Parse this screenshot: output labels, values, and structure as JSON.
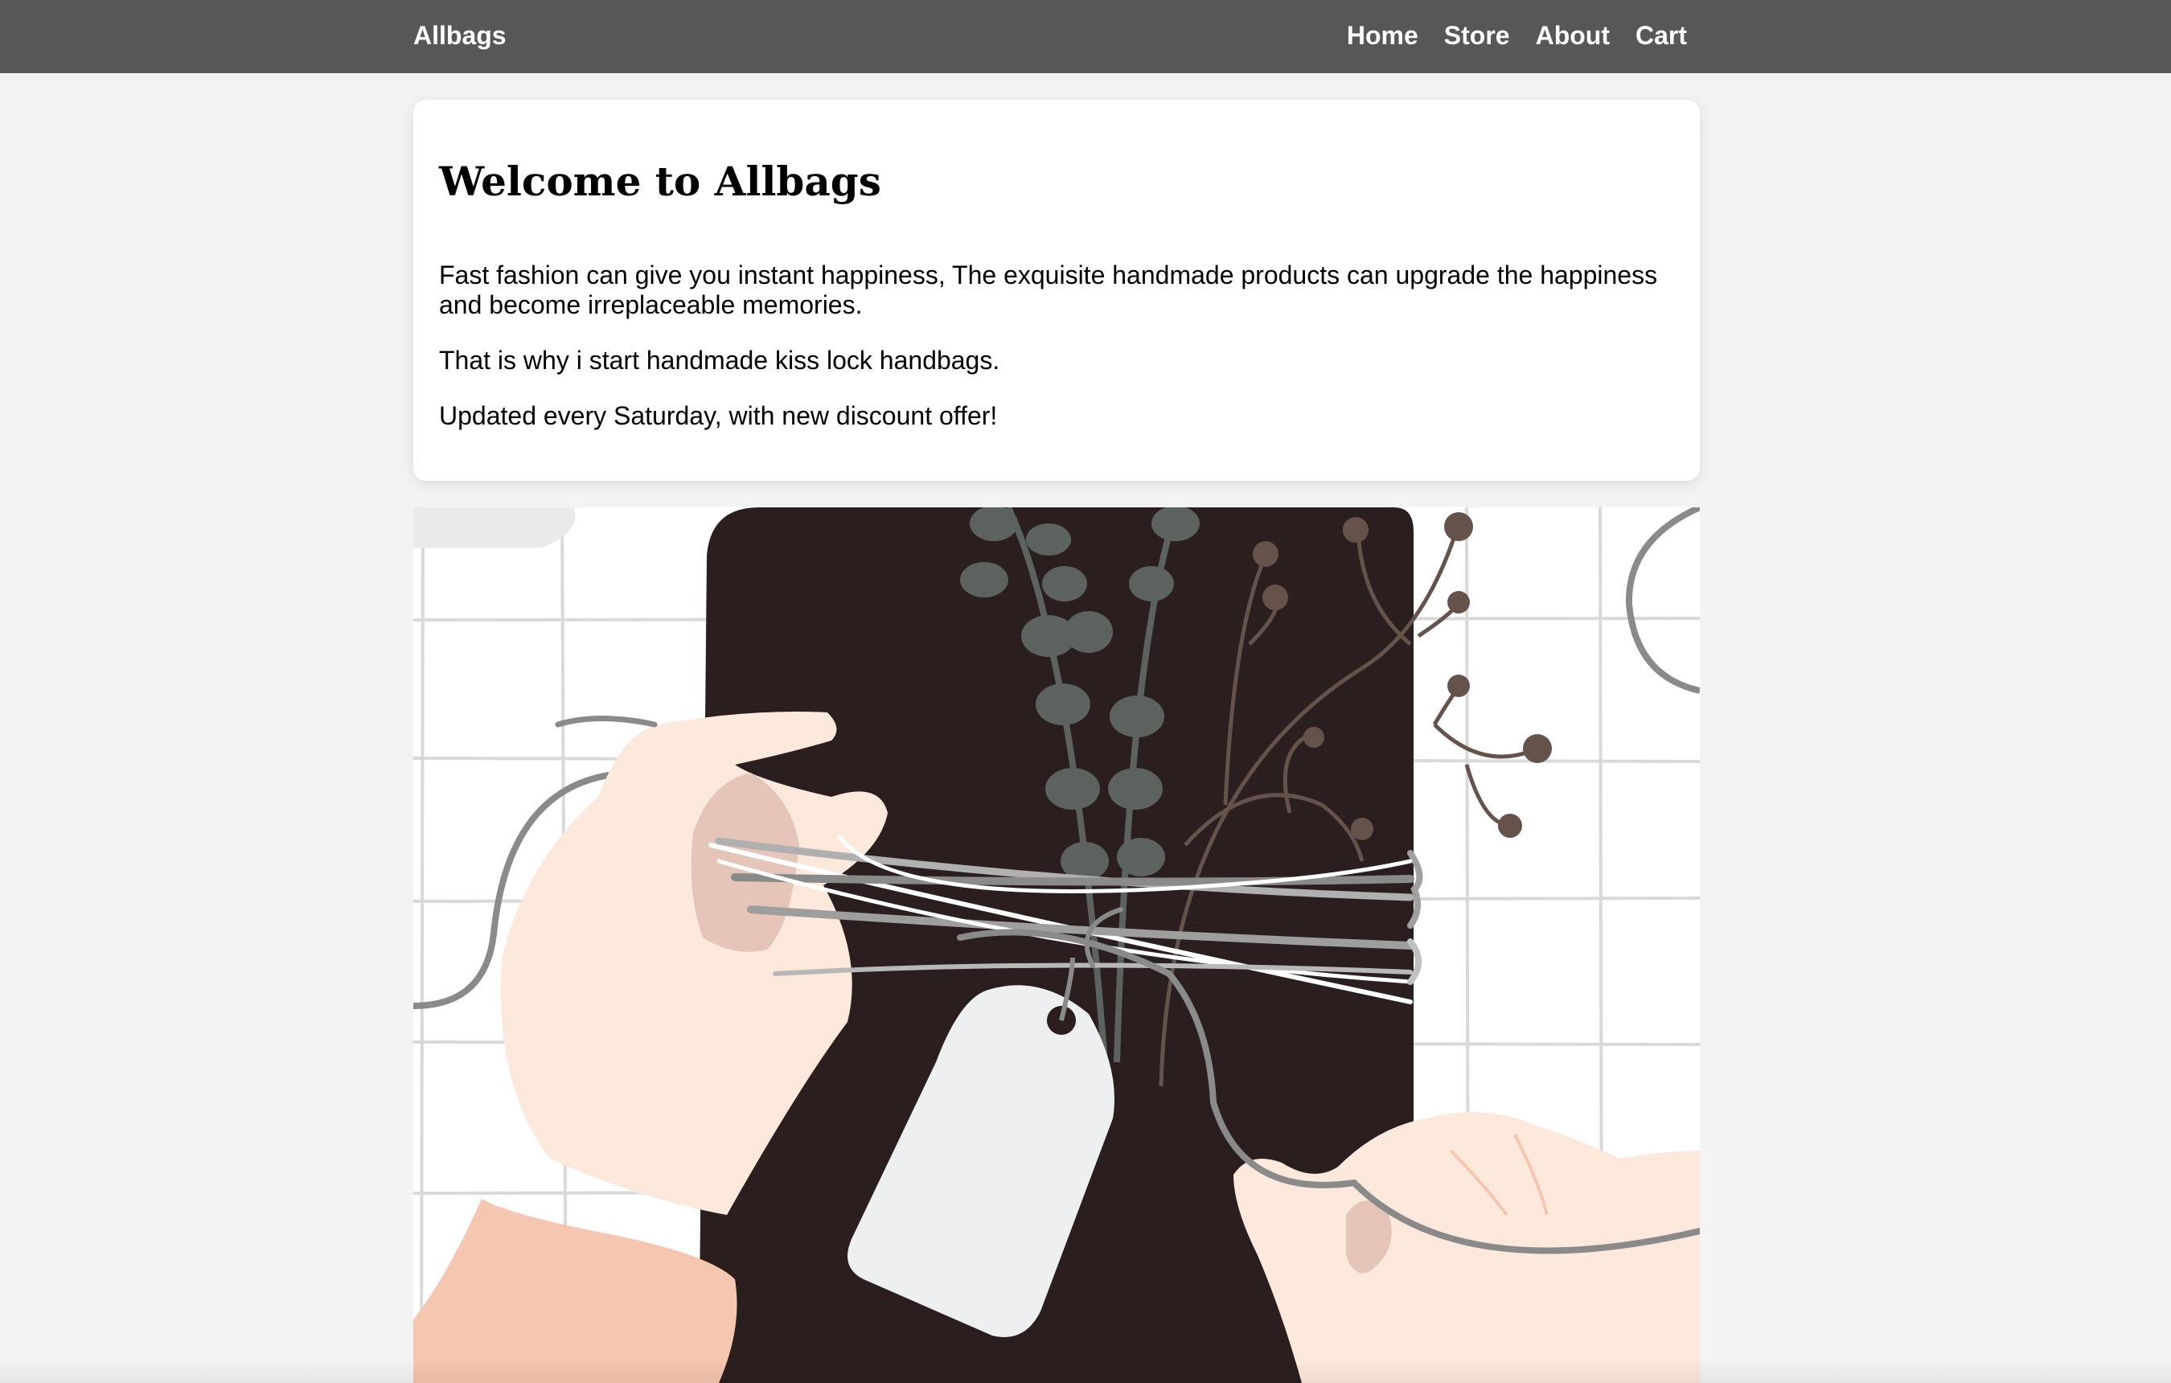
{
  "navbar": {
    "brand": "Allbags",
    "links": [
      "Home",
      "Store",
      "About",
      "Cart"
    ]
  },
  "welcome": {
    "title": "Welcome to Allbags",
    "paragraphs": [
      "Fast fashion can give you instant happiness, The exquisite handmade products can upgrade the happiness and become irreplaceable memories.",
      "That is why i start handmade kiss lock handbags.",
      "Updated every Saturday, with new discount offer!"
    ]
  },
  "hero": {
    "icon": "gift-wrapping-illustration"
  },
  "colors": {
    "navbar": "#575757",
    "page_background": "#f3f3f3",
    "card_background": "#ffffff",
    "package": "#2a1f1e",
    "skin": "#fde8dc",
    "sleeve": "#f5c6b0",
    "leaf": "#5c635f",
    "twig": "#65524a",
    "string": "#8a8a8a",
    "tag": "#eeeff1"
  }
}
